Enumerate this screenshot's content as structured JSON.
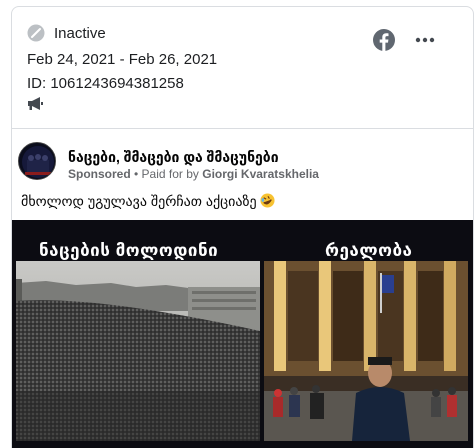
{
  "meta": {
    "status": "Inactive",
    "date_range": "Feb 24, 2021 - Feb 26, 2021",
    "ad_id": "ID: 1061243694381258",
    "status_icon": "inactive-slash-icon",
    "platform_icon": "megaphone-icon",
    "network_icon": "facebook-icon",
    "menu_icon": "more-options-icon"
  },
  "post": {
    "page_name": "ნაცები, შმაცები და შმაცუნები",
    "sponsored": "Sponsored",
    "paid_for_prefix": " • Paid for by ",
    "paid_for_name": "Giorgi Kvaratskhelia",
    "caption": "მხოლოდ უგულავა შერჩათ აქციაზე",
    "caption_emoji": "rolling-on-floor-laughing-emoji"
  },
  "creative": {
    "heading_left": "ნაცების მოლოდინი",
    "heading_right": "რეალობა"
  },
  "colors": {
    "text": "#1c1e21",
    "secondary_text": "#65676b",
    "border": "#dadde1",
    "facebook_blue": "#606770",
    "creative_bg": "#0c0c12"
  }
}
